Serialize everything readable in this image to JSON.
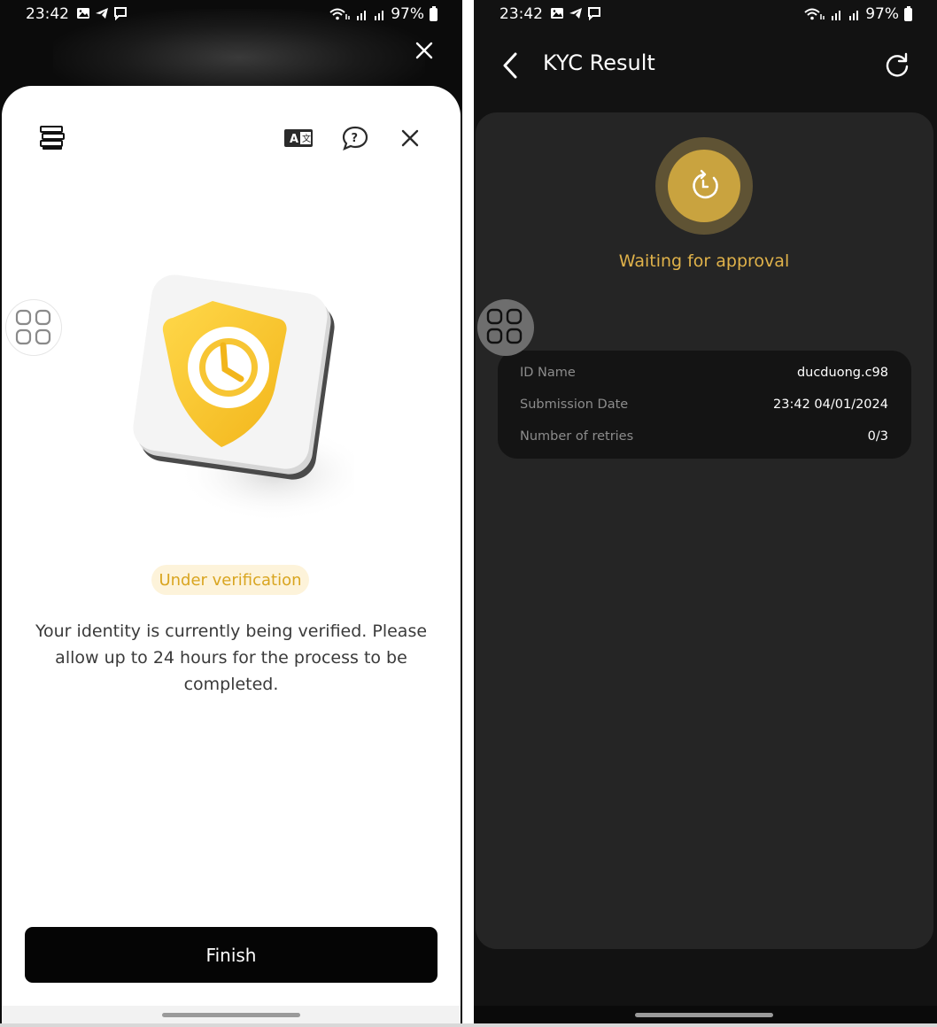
{
  "left": {
    "status_bar": {
      "time": "23:42",
      "battery": "97%"
    },
    "toolbar": {
      "logo_icon": "stacked-logo-icon",
      "translate_icon": "translate-icon",
      "help_icon": "help-chat-icon",
      "close_icon": "close-icon"
    },
    "illustration_icon": "shield-clock-icon",
    "badge": "Under verification",
    "description": "Your identity is currently being verified. Please allow up to 24 hours for the process to be completed.",
    "finish_label": "Finish"
  },
  "right": {
    "status_bar": {
      "time": "23:42",
      "battery": "97%"
    },
    "header": {
      "title": "KYC Result"
    },
    "status": {
      "label": "Waiting for approval",
      "icon": "clock-refresh-icon",
      "accent": "#c9a33f"
    },
    "details": [
      {
        "label": "ID Name",
        "value": "ducduong.c98"
      },
      {
        "label": "Submission Date",
        "value": "23:42 04/01/2024"
      },
      {
        "label": "Number of retries",
        "value": "0/3"
      }
    ]
  }
}
